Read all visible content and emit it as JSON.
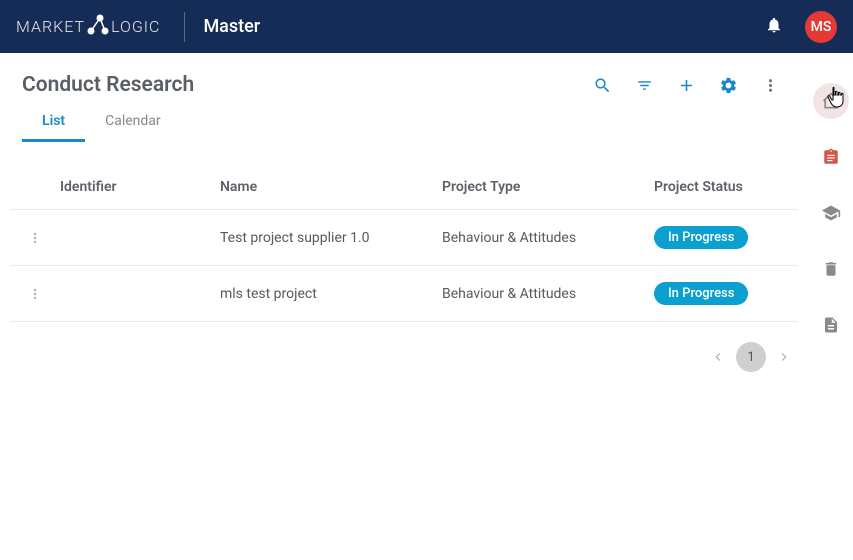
{
  "header": {
    "brand_left": "MARKET",
    "brand_right": "LOGIC",
    "workspace": "Master",
    "avatar_initials": "MS"
  },
  "page": {
    "title": "Conduct Research",
    "tabs": [
      {
        "label": "List",
        "active": true
      },
      {
        "label": "Calendar",
        "active": false
      }
    ]
  },
  "table": {
    "columns": {
      "identifier": "Identifier",
      "name": "Name",
      "type": "Project Type",
      "status": "Project Status"
    },
    "rows": [
      {
        "identifier": "",
        "name": "Test project supplier 1.0",
        "type": "Behaviour & Attitudes",
        "status": "In Progress",
        "status_color": "#0ba0d0"
      },
      {
        "identifier": "",
        "name": "mls test project",
        "type": "Behaviour & Attitudes",
        "status": "In Progress",
        "status_color": "#0ba0d0"
      }
    ]
  },
  "pagination": {
    "current": "1"
  },
  "right_rail_icons": [
    "home-icon",
    "clipboard-icon",
    "graduation-icon",
    "trash-icon",
    "document-icon"
  ]
}
